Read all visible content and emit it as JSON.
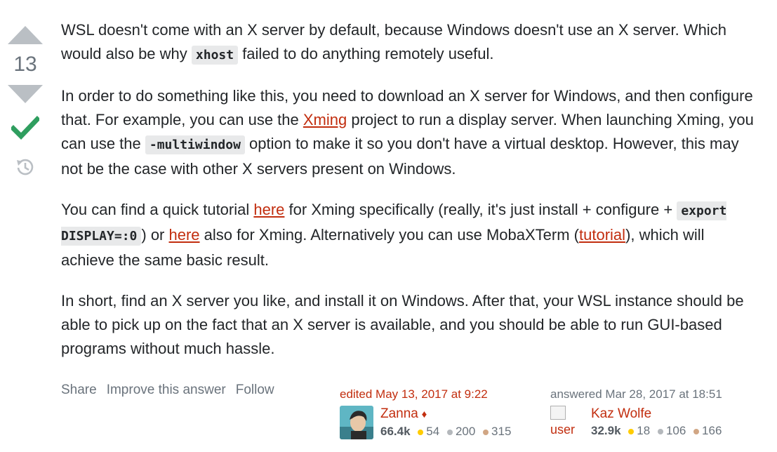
{
  "vote": {
    "count": "13"
  },
  "post": {
    "p1": {
      "t1": "WSL doesn't come with an X server by default, because Windows doesn't use an X server. Which would also be why ",
      "code1": "xhost",
      "t2": " failed to do anything remotely useful."
    },
    "p2": {
      "t1": "In order to do something like this, you need to download an X server for Windows, and then configure that. For example, you can use the ",
      "link1": "Xming",
      "t2": " project to run a display server. When launching Xming, you can use the ",
      "code1": "-multiwindow",
      "t3": " option to make it so you don't have a virtual desktop. However, this may not be the case with other X servers present on Windows."
    },
    "p3": {
      "t1": "You can find a quick tutorial ",
      "link1": "here",
      "t2": " for Xming specifically (really, it's just install + configure + ",
      "code1": "export DISPLAY=:0",
      "t3": ") or ",
      "link2": "here",
      "t4": " also for Xming. Alternatively you can use MobaXTerm (",
      "link3": "tutorial",
      "t5": "), which will achieve the same basic result."
    },
    "p4": {
      "t1": "In short, find an X server you like, and install it on Windows. After that, your WSL instance should be able to pick up on the fact that an X server is available, and you should be able to run GUI-based programs without much hassle."
    }
  },
  "actions": {
    "share": "Share",
    "improve": "Improve this answer",
    "follow": "Follow"
  },
  "editor": {
    "action_time": "edited May 13, 2017 at 9:22",
    "name": "Zanna",
    "diamond": "♦",
    "rep": "66.4k",
    "gold": "54",
    "silver": "200",
    "bronze": "315"
  },
  "author": {
    "action_time": "answered Mar 28, 2017 at 18:51",
    "avatar_alt": "user",
    "name": "Kaz Wolfe",
    "rep": "32.9k",
    "gold": "18",
    "silver": "106",
    "bronze": "166"
  },
  "colors": {
    "accent_link": "#c22e0f",
    "accepted_check": "#2f9e5f",
    "vote_arrow": "#babfc4"
  }
}
